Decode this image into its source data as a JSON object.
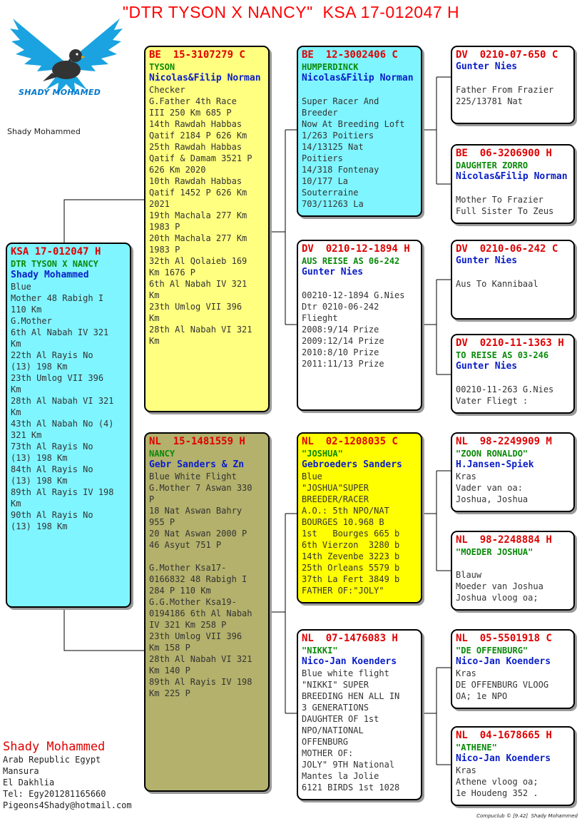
{
  "title": "\"DTR TYSON X NANCY\"  KSA 17-012047 H",
  "logo": {
    "caption": "SHADY MOHAMED"
  },
  "owner_small": "Shady Mohammed",
  "subject": {
    "ring": "KSA 17-012047 H",
    "name": "DTR TYSON X NANCY",
    "breeder": "Shady Mohammed",
    "info": "Blue\nMother 48 Rabigh I\n110 Km\nG.Mother\n6th Al Nabah IV 321\nKm\n22th Al Rayis No\n(13) 198 Km\n23th Umlog VII 396\nKm\n28th Al Nabah VI 321\nKm\n43th Al Nabah No (4)\n321 Km\n73th Al Rayis No\n(13) 198 Km\n84th Al Rayis No\n(13) 198 Km\n89th Al Rayis IV 198\nKm\n90th Al Rayis No\n(13) 198 Km"
  },
  "sire": {
    "ring": "BE  15-3107279 C",
    "name": "TYSON",
    "breeder": "Nicolas&Filip Norman",
    "info": "Checker\nG.Father 4th Race\nIII 250 Km 685 P\n14th Rawdah Habbas\nQatif 2184 P 626 Km\n25th Rawdah Habbas\nQatif & Damam 3521 P\n626 Km 2020\n10th Rawdah Habbas\nQatif 1452 P 626 Km\n2021\n19th Machala 277 Km\n1983 P\n20th Machala 277 Km\n1983 P\n32th Al Qolaieb 169\nKm 1676 P\n6th Al Nabah IV 321\nKm\n23th Umlog VII 396\nKm\n28th Al Nabah VI 321\nKm"
  },
  "dam": {
    "ring": "NL  15-1481559 H",
    "name": "NANCY",
    "breeder": "Gebr Sanders & Zn",
    "info": "Blue White Flight\nG.Mother 7 Aswan 330\nP\n18 Nat Aswan Bahry\n955 P\n20 Nat Aswan 2000 P\n46 Asyut 751 P\n\nG.Mother Ksa17-\n0166832 48 Rabigh I\n284 P 110 Km\nG.G.Mother Ksa19-\n0194186 6th Al Nabah\nIV 321 Km 258 P\n23th Umlog VII 396\nKm 158 P\n28th Al Nabah VI 321\nKm 140 P\n89th Al Rayis IV 198\nKm 225 P"
  },
  "ss": {
    "ring": "BE  12-3002406 C",
    "name": "HUMPERDINCK",
    "breeder": "Nicolas&Filip Norman",
    "info": "\nSuper Racer And\nBreeder\nNow At Breeding Loft\n1/263 Poitiers\n14/13125 Nat\nPoitiers\n14/318 Fontenay\n10/177 La\nSouterraine\n703/11263 La"
  },
  "sd": {
    "ring": "DV  0210-12-1894 H",
    "name": "AUS REISE AS 06-242",
    "breeder": "Gunter Nies",
    "info": "\n00210-12-1894 G.Nies\nDtr 0210-06-242\nFlieght\n2008:9/14 Prize\n2009:12/14 Prize\n2010:8/10 Prize\n2011:11/13 Prize"
  },
  "ds": {
    "ring": "NL  02-1208035 C",
    "name": "\"JOSHUA\"",
    "breeder": "Gebroeders Sanders",
    "info": "Blue\n\"JOSHUA\"SUPER\nBREEDER/RACER\nA.O.: 5th NPO/NAT\nBOURGES 10.968 B\n1st   Bourges 665 b\n6th Vierzon  3280 b\n14th Zevenbe 3223 b\n25th Orleans 5579 b\n37th La Fert 3849 b\nFATHER OF:\"JOLY\""
  },
  "dd": {
    "ring": "NL  07-1476083 H",
    "name": "\"NIKKI\"",
    "breeder": "Nico-Jan Koenders",
    "info": "Blue white flight\n\"NIKKI\" SUPER\nBREEDING HEN ALL IN\n3 GENERATIONS\nDAUGHTER OF 1st\nNPO/NATIONAL\nOFFENBURG\nMOTHER OF:\nJOLY\" 9TH National\nMantes la Jolie\n6121 BIRDS 1st 1028"
  },
  "sss": {
    "ring": "DV  0210-07-650 C",
    "name": "",
    "breeder": "Gunter Nies",
    "info": "\nFather From Frazier\n225/13781 Nat"
  },
  "ssd": {
    "ring": "BE  06-3206900 H",
    "name": "DAUGHTER ZORRO",
    "breeder": "Nicolas&Filip Norman",
    "info": "\nMother To Frazier\nFull Sister To Zeus"
  },
  "sds": {
    "ring": "DV  0210-06-242 C",
    "name": "",
    "breeder": "Gunter Nies",
    "info": "\nAus To Kannibaal"
  },
  "sdd": {
    "ring": "DV  0210-11-1363 H",
    "name": "TO REISE AS 03-246",
    "breeder": "Gunter Nies",
    "info": "\n00210-11-263 G.Nies\nVater Fliegt :"
  },
  "dss": {
    "ring": "NL  98-2249909 M",
    "name": "\"ZOON RONALDO\"",
    "breeder": "H.Jansen-Spiek",
    "info": "Kras\nVader van oa:\nJoshua, Joshua"
  },
  "dsd": {
    "ring": "NL  98-2248884 H",
    "name": "\"MOEDER JOSHUA\"",
    "breeder": "",
    "info": "\nBlauw\nMoeder van Joshua\nJoshua vloog oa;"
  },
  "dds": {
    "ring": "NL  05-5501918 C",
    "name": "\"DE OFFENBURG\"",
    "breeder": "Nico-Jan Koenders",
    "info": "Kras\nDE OFFENBURG VLOOG\nOA; 1e NPO"
  },
  "ddd": {
    "ring": "NL  04-1678665 H",
    "name": "\"ATHENE\"",
    "breeder": "Nico-Jan Koenders",
    "info": "Kras\nAthene vloog oa;\n1e Houdeng 352 ."
  },
  "contact": {
    "name": "Shady Mohammed",
    "country": "Arab Republic Egypt",
    "city": "Mansura",
    "region": "El Dakhlia",
    "tel": "Tel: Egy201281165660",
    "email": "Pigeons4Shady@hotmail.com"
  },
  "footer": "Compuclub © [9.42]  Shady Mohammed",
  "colors": {
    "ring": "#e00000",
    "name": "#0a8a0a",
    "breeder": "#0a1ec8",
    "cyan": "#7ff5ff",
    "yellow": "#ffff80",
    "bright_yellow": "#ffff00",
    "olive": "#b3b16b"
  },
  "icons": {
    "logo": "winged-pigeon-logo-icon"
  }
}
